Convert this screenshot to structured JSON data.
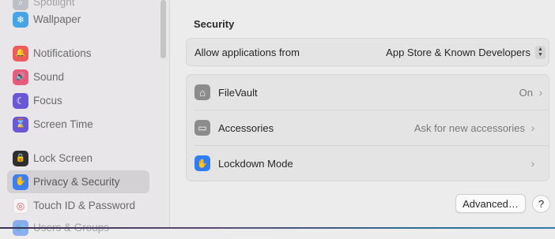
{
  "sidebar": {
    "items": [
      {
        "label": "Spotlight",
        "icon": "spotlight-icon",
        "color": "#9aa1ad",
        "glyph": "⌕"
      },
      {
        "label": "Wallpaper",
        "icon": "wallpaper-icon",
        "color": "#46a4e6",
        "glyph": "❄"
      },
      {
        "label": "Notifications",
        "icon": "notifications-icon",
        "color": "#ee5b5b",
        "glyph": "🔔"
      },
      {
        "label": "Sound",
        "icon": "sound-icon",
        "color": "#e85a7c",
        "glyph": "🔊"
      },
      {
        "label": "Focus",
        "icon": "focus-icon",
        "color": "#6a57d6",
        "glyph": "☾"
      },
      {
        "label": "Screen Time",
        "icon": "screen-time-icon",
        "color": "#6a57d6",
        "glyph": "⌛"
      },
      {
        "label": "Lock Screen",
        "icon": "lock-icon",
        "color": "#2f2f2f",
        "glyph": "🔒"
      },
      {
        "label": "Privacy & Security",
        "icon": "privacy-hand-icon",
        "color": "#3d7ef0",
        "glyph": "✋"
      },
      {
        "label": "Touch ID & Password",
        "icon": "fingerprint-icon",
        "color": "#f4f4f4",
        "glyph": "◎"
      },
      {
        "label": "Users & Groups",
        "icon": "users-icon",
        "color": "#3d7ef0",
        "glyph": "👥"
      }
    ]
  },
  "main": {
    "section_title": "Security",
    "allow": {
      "label": "Allow applications from",
      "value": "App Store & Known Developers"
    },
    "rows": [
      {
        "label": "FileVault",
        "value": "On",
        "icon": "filevault-icon",
        "color": "#8c8c8c",
        "glyph": "⌂"
      },
      {
        "label": "Accessories",
        "value": "Ask for new accessories",
        "icon": "accessories-icon",
        "color": "#8c8c8c",
        "glyph": "▭"
      },
      {
        "label": "Lockdown Mode",
        "value": "",
        "icon": "lockdown-hand-icon",
        "color": "#2f7ef5",
        "glyph": "✋"
      }
    ],
    "advanced_label": "Advanced…",
    "help_label": "?"
  }
}
